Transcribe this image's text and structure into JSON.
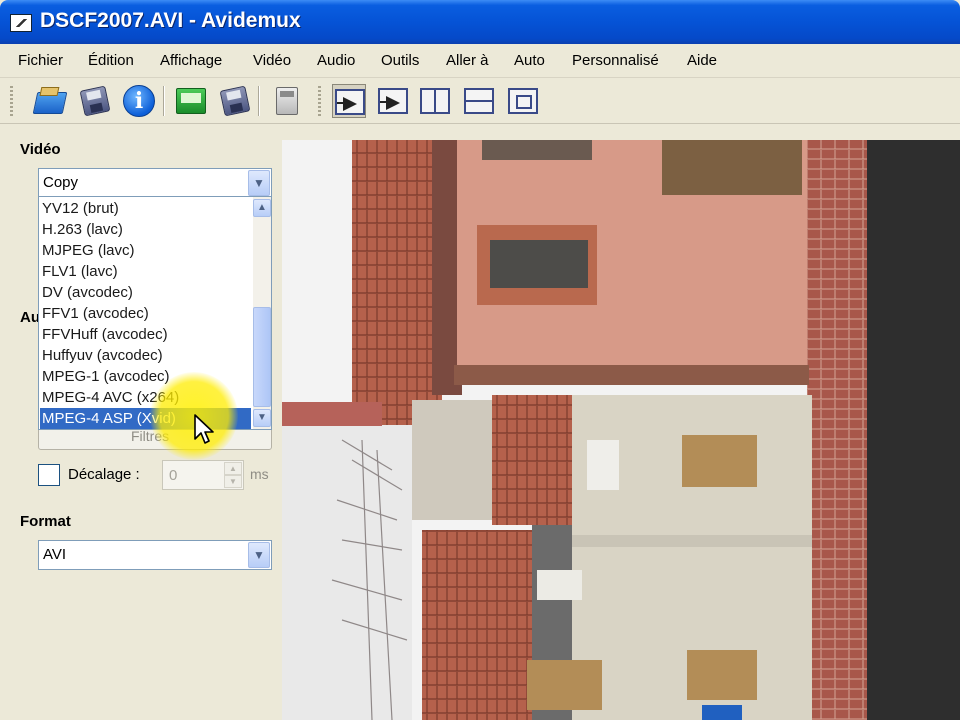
{
  "window": {
    "title": "DSCF2007.AVI - Avidemux"
  },
  "menubar": {
    "items": [
      "Fichier",
      "Édition",
      "Affichage",
      "Vidéo",
      "Audio",
      "Outils",
      "Aller à",
      "Auto",
      "Personnalisé",
      "Aide"
    ]
  },
  "toolbar": {
    "left_icons": [
      "open-icon",
      "save-icon",
      "info-icon",
      "save-as-green-icon",
      "save-disk-icon",
      "calculator-icon"
    ],
    "view_icons": [
      "play-output-icon",
      "next-frame-icon",
      "split-vertical-icon",
      "split-horizontal-icon",
      "inner-frame-icon"
    ]
  },
  "video": {
    "label": "Vidéo",
    "codec_selected": "Copy",
    "codec_options": [
      "YV12 (brut)",
      "H.263 (lavc)",
      "MJPEG (lavc)",
      "FLV1 (lavc)",
      "DV (avcodec)",
      "FFV1 (avcodec)",
      "FFVHuff (avcodec)",
      "Huffyuv (avcodec)",
      "MPEG-1 (avcodec)",
      "MPEG-4 AVC (x264)",
      "MPEG-4 ASP (Xvid)"
    ],
    "highlighted_option": "MPEG-4 ASP (Xvid)"
  },
  "audio": {
    "label_partial": "Au",
    "filters_label": "Filtres",
    "offset_label": "Décalage :",
    "offset_value": "0",
    "offset_unit": "ms",
    "offset_checked": false
  },
  "format": {
    "label": "Format",
    "selected": "AVI"
  },
  "colors": {
    "titlebar": "#0553d6",
    "selection": "#316ac5",
    "panel_bg": "#ece9d8",
    "cursor_highlight": "#ffec00"
  }
}
